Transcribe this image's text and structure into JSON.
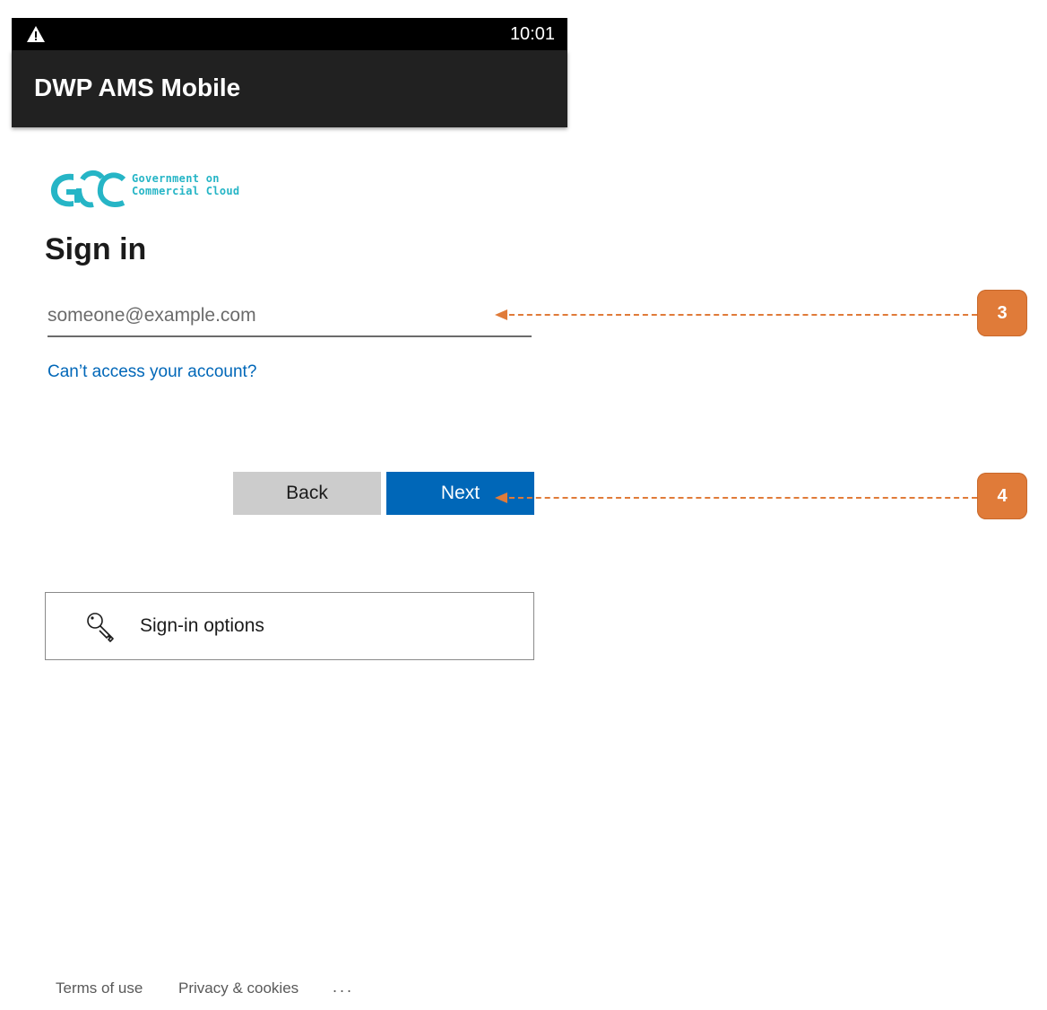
{
  "statusbar": {
    "time": "10:01",
    "warning_icon": "warning-triangle-icon"
  },
  "appbar": {
    "title": "DWP AMS Mobile"
  },
  "logo": {
    "line1": "Government on",
    "line2": "Commercial Cloud",
    "accent": "#26b5c6"
  },
  "signin": {
    "heading": "Sign in",
    "email_placeholder": "someone@example.com",
    "cant_access": "Can’t access your account?",
    "back_label": "Back",
    "next_label": "Next",
    "options_label": "Sign-in options",
    "options_icon": "key-icon"
  },
  "footer": {
    "terms": "Terms of use",
    "privacy": "Privacy & cookies",
    "more": "..."
  },
  "callouts": [
    {
      "number": "3"
    },
    {
      "number": "4"
    }
  ],
  "colors": {
    "primary": "#0067b8",
    "callout": "#e07b39",
    "appbar": "#212121"
  }
}
